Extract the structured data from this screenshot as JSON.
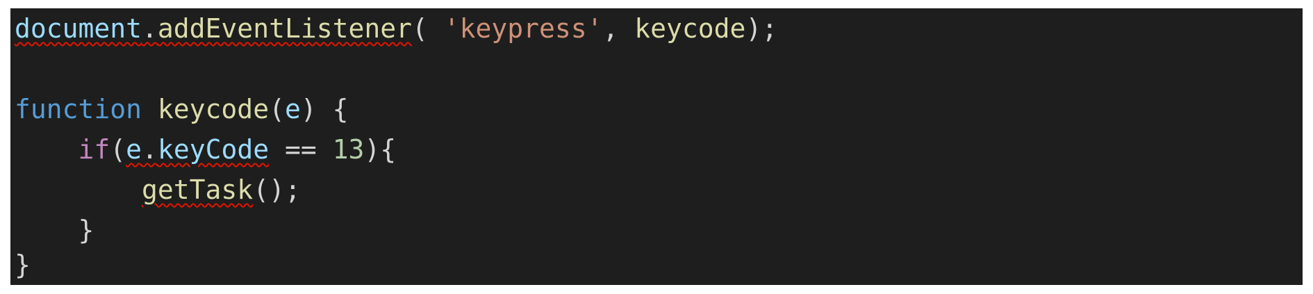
{
  "editor": {
    "theme_colors": {
      "background": "#1e1e1e",
      "variable": "#9cdcfe",
      "function": "#dcdcaa",
      "string": "#ce9178",
      "keyword": "#569cd6",
      "control": "#c586c0",
      "number": "#b5cea8",
      "punctuation": "#d4d4d4",
      "error_squiggle": "#e51400"
    },
    "lines": {
      "line1": {
        "document": "document",
        "dot": ".",
        "addEventListener": "addEventListener",
        "open": "( ",
        "string": "'keypress'",
        "comma": ", ",
        "arg": "keycode",
        "close": ");"
      },
      "line3": {
        "keyword": "function",
        "space": " ",
        "name": "keycode",
        "open": "(",
        "param": "e",
        "close": ") {"
      },
      "line4": {
        "indent": "    ",
        "keyword": "if",
        "open": "(",
        "obj": "e",
        "dot": ".",
        "prop": "keyCode",
        "op": " == ",
        "number": "13",
        "close": "){"
      },
      "line5": {
        "indent": "        ",
        "call": "getTask",
        "rest": "();"
      },
      "line6": {
        "indent": "    ",
        "brace": "}"
      },
      "line7": {
        "brace": "}"
      }
    }
  }
}
